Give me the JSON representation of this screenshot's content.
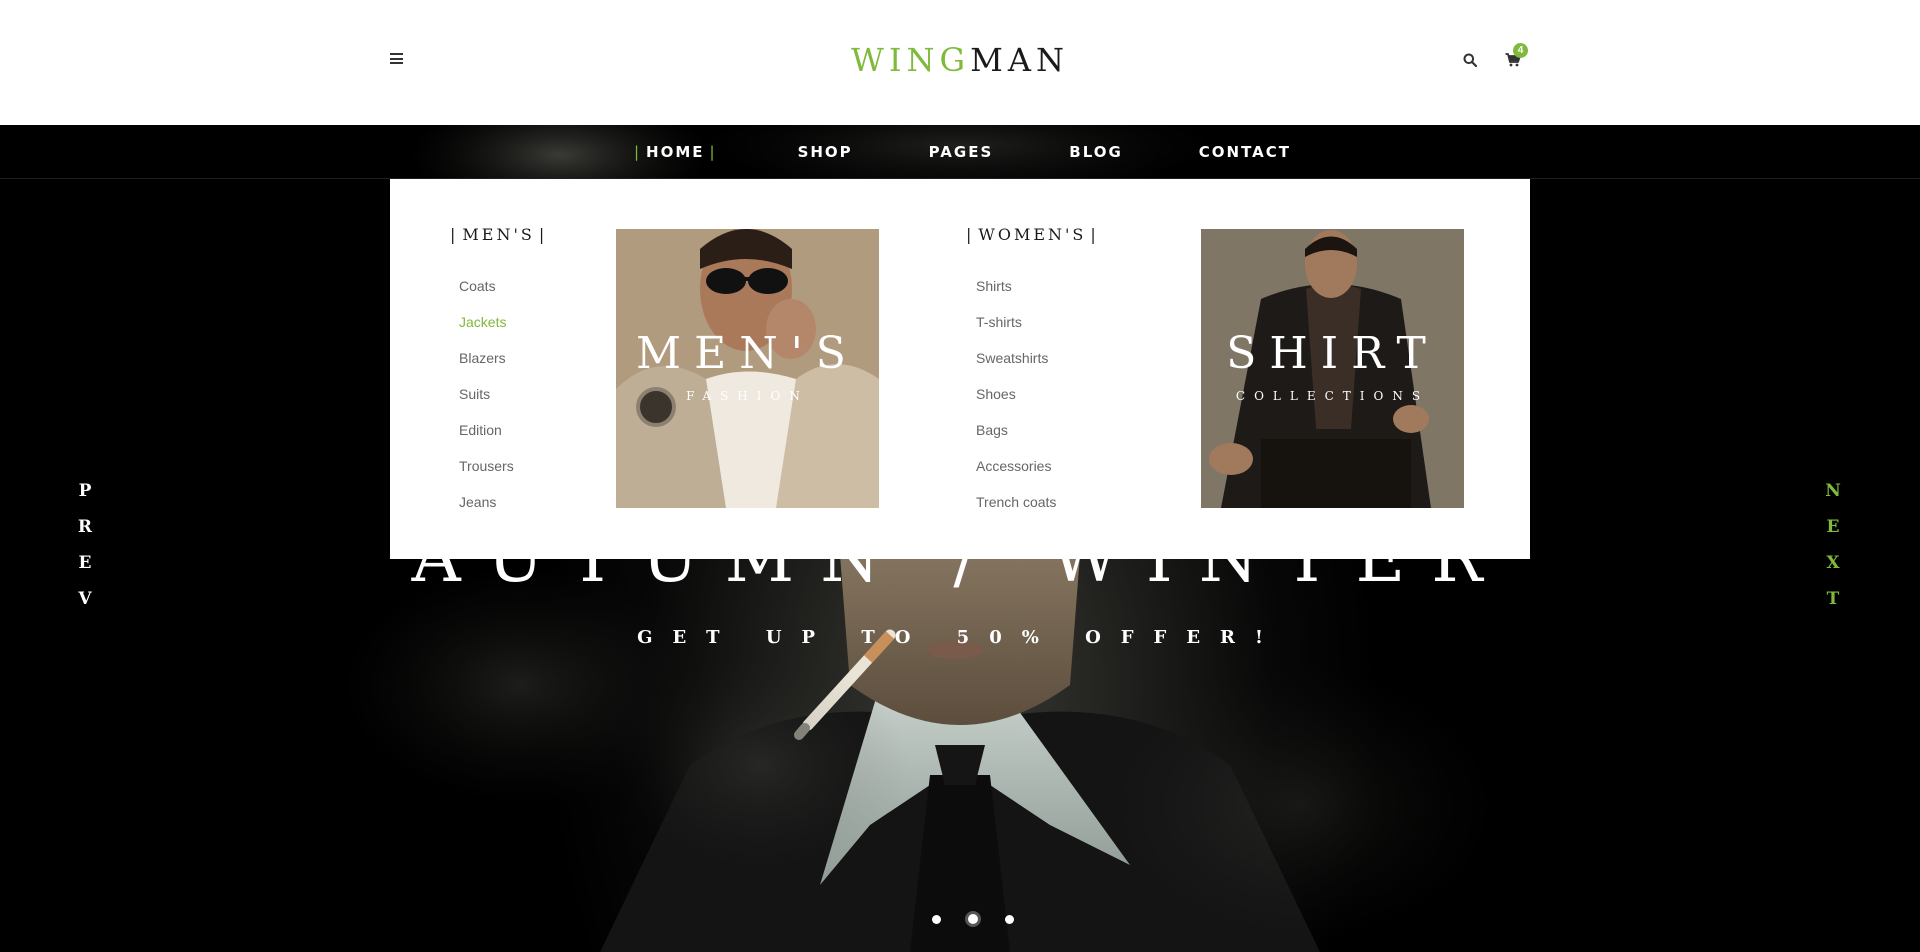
{
  "header": {
    "logo_accent": "WING",
    "logo_dark": "MAN",
    "cart_count": "4"
  },
  "nav": {
    "items": [
      {
        "label": "HOME",
        "active": true
      },
      {
        "label": "SHOP"
      },
      {
        "label": "PAGES"
      },
      {
        "label": "BLOG"
      },
      {
        "label": "CONTACT"
      }
    ]
  },
  "mega_menu": {
    "mens": {
      "title": "MEN'S",
      "items": [
        "Coats",
        "Jackets",
        "Blazers",
        "Suits",
        "Edition",
        "Trousers",
        "Jeans"
      ],
      "active_item": "Jackets",
      "promo_title": "MEN'S",
      "promo_subtitle": "FASHION"
    },
    "womens": {
      "title": "WOMEN'S",
      "items": [
        "Shirts",
        "T-shirts",
        "Sweatshirts",
        "Shoes",
        "Bags",
        "Accessories",
        "Trench coats"
      ],
      "promo_title": "SHIRT",
      "promo_subtitle": "COLLECTIONS"
    }
  },
  "slider": {
    "title": "AUTUMN / WINTER",
    "subtitle": "GET UP TO 50% OFFER!",
    "prev_label": "PREV",
    "next_label": "NEXT",
    "slide_count": 3,
    "active_slide": 2
  },
  "colors": {
    "accent": "#7fba3c",
    "dark": "#1a1a1a",
    "menu_text": "#666666"
  },
  "icons": [
    "hamburger-icon",
    "search-icon",
    "cart-icon"
  ]
}
